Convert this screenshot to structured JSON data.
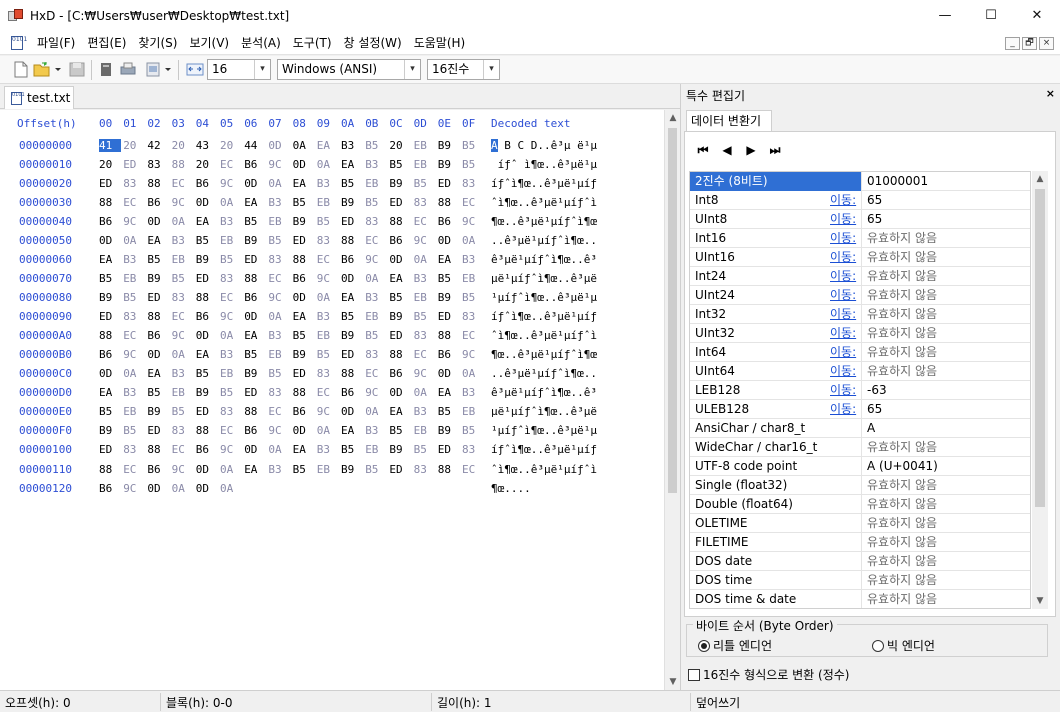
{
  "window": {
    "title": "HxD - [C:₩Users₩user₩Desktop₩test.txt]",
    "minimize": "—",
    "maximize": "☐",
    "close": "✕",
    "app_icon": "hxd-icon"
  },
  "menu": {
    "items": [
      "파일(F)",
      "편집(E)",
      "찾기(S)",
      "보기(V)",
      "분석(A)",
      "도구(T)",
      "창 설정(W)",
      "도움말(H)"
    ],
    "doc_icon_text": "0101",
    "mdi_minimize": "_",
    "mdi_restore": "🗗",
    "mdi_close": "×"
  },
  "toolbar": {
    "bytes_per_row": "16",
    "charset": "Windows (ANSI)",
    "offset_base": "16진수",
    "dropdown_arrow": "▾"
  },
  "tab": {
    "file_name": "test.txt",
    "icon_text": "0101"
  },
  "hex": {
    "header_offset": "Offset(h)",
    "header_columns": [
      "00",
      "01",
      "02",
      "03",
      "04",
      "05",
      "06",
      "07",
      "08",
      "09",
      "0A",
      "0B",
      "0C",
      "0D",
      "0E",
      "0F"
    ],
    "header_decoded": "Decoded text",
    "rows": [
      {
        "offset": "00000000",
        "bytes": [
          "41",
          "20",
          "42",
          "20",
          "43",
          "20",
          "44",
          "0D",
          "0A",
          "EA",
          "B3",
          "B5",
          "20",
          "EB",
          "B9",
          "B5"
        ],
        "decoded": "A B C D..ê³µ ë¹µ"
      },
      {
        "offset": "00000010",
        "bytes": [
          "20",
          "ED",
          "83",
          "88",
          "20",
          "EC",
          "B6",
          "9C",
          "0D",
          "0A",
          "EA",
          "B3",
          "B5",
          "EB",
          "B9",
          "B5"
        ],
        "decoded": " íƒˆ ì¶œ..ê³µë¹µ"
      },
      {
        "offset": "00000020",
        "bytes": [
          "ED",
          "83",
          "88",
          "EC",
          "B6",
          "9C",
          "0D",
          "0A",
          "EA",
          "B3",
          "B5",
          "EB",
          "B9",
          "B5",
          "ED",
          "83"
        ],
        "decoded": "íƒˆì¶œ..ê³µë¹µíƒ"
      },
      {
        "offset": "00000030",
        "bytes": [
          "88",
          "EC",
          "B6",
          "9C",
          "0D",
          "0A",
          "EA",
          "B3",
          "B5",
          "EB",
          "B9",
          "B5",
          "ED",
          "83",
          "88",
          "EC"
        ],
        "decoded": "ˆì¶œ..ê³µë¹µíƒˆì"
      },
      {
        "offset": "00000040",
        "bytes": [
          "B6",
          "9C",
          "0D",
          "0A",
          "EA",
          "B3",
          "B5",
          "EB",
          "B9",
          "B5",
          "ED",
          "83",
          "88",
          "EC",
          "B6",
          "9C"
        ],
        "decoded": "¶œ..ê³µë¹µíƒˆì¶œ"
      },
      {
        "offset": "00000050",
        "bytes": [
          "0D",
          "0A",
          "EA",
          "B3",
          "B5",
          "EB",
          "B9",
          "B5",
          "ED",
          "83",
          "88",
          "EC",
          "B6",
          "9C",
          "0D",
          "0A"
        ],
        "decoded": "..ê³µë¹µíƒˆì¶œ.."
      },
      {
        "offset": "00000060",
        "bytes": [
          "EA",
          "B3",
          "B5",
          "EB",
          "B9",
          "B5",
          "ED",
          "83",
          "88",
          "EC",
          "B6",
          "9C",
          "0D",
          "0A",
          "EA",
          "B3"
        ],
        "decoded": "ê³µë¹µíƒˆì¶œ..ê³"
      },
      {
        "offset": "00000070",
        "bytes": [
          "B5",
          "EB",
          "B9",
          "B5",
          "ED",
          "83",
          "88",
          "EC",
          "B6",
          "9C",
          "0D",
          "0A",
          "EA",
          "B3",
          "B5",
          "EB"
        ],
        "decoded": "µë¹µíƒˆì¶œ..ê³µë"
      },
      {
        "offset": "00000080",
        "bytes": [
          "B9",
          "B5",
          "ED",
          "83",
          "88",
          "EC",
          "B6",
          "9C",
          "0D",
          "0A",
          "EA",
          "B3",
          "B5",
          "EB",
          "B9",
          "B5"
        ],
        "decoded": "¹µíƒˆì¶œ..ê³µë¹µ"
      },
      {
        "offset": "00000090",
        "bytes": [
          "ED",
          "83",
          "88",
          "EC",
          "B6",
          "9C",
          "0D",
          "0A",
          "EA",
          "B3",
          "B5",
          "EB",
          "B9",
          "B5",
          "ED",
          "83"
        ],
        "decoded": "íƒˆì¶œ..ê³µë¹µíƒ"
      },
      {
        "offset": "000000A0",
        "bytes": [
          "88",
          "EC",
          "B6",
          "9C",
          "0D",
          "0A",
          "EA",
          "B3",
          "B5",
          "EB",
          "B9",
          "B5",
          "ED",
          "83",
          "88",
          "EC"
        ],
        "decoded": "ˆì¶œ..ê³µë¹µíƒˆì"
      },
      {
        "offset": "000000B0",
        "bytes": [
          "B6",
          "9C",
          "0D",
          "0A",
          "EA",
          "B3",
          "B5",
          "EB",
          "B9",
          "B5",
          "ED",
          "83",
          "88",
          "EC",
          "B6",
          "9C"
        ],
        "decoded": "¶œ..ê³µë¹µíƒˆì¶œ"
      },
      {
        "offset": "000000C0",
        "bytes": [
          "0D",
          "0A",
          "EA",
          "B3",
          "B5",
          "EB",
          "B9",
          "B5",
          "ED",
          "83",
          "88",
          "EC",
          "B6",
          "9C",
          "0D",
          "0A"
        ],
        "decoded": "..ê³µë¹µíƒˆì¶œ.."
      },
      {
        "offset": "000000D0",
        "bytes": [
          "EA",
          "B3",
          "B5",
          "EB",
          "B9",
          "B5",
          "ED",
          "83",
          "88",
          "EC",
          "B6",
          "9C",
          "0D",
          "0A",
          "EA",
          "B3"
        ],
        "decoded": "ê³µë¹µíƒˆì¶œ..ê³"
      },
      {
        "offset": "000000E0",
        "bytes": [
          "B5",
          "EB",
          "B9",
          "B5",
          "ED",
          "83",
          "88",
          "EC",
          "B6",
          "9C",
          "0D",
          "0A",
          "EA",
          "B3",
          "B5",
          "EB"
        ],
        "decoded": "µë¹µíƒˆì¶œ..ê³µë"
      },
      {
        "offset": "000000F0",
        "bytes": [
          "B9",
          "B5",
          "ED",
          "83",
          "88",
          "EC",
          "B6",
          "9C",
          "0D",
          "0A",
          "EA",
          "B3",
          "B5",
          "EB",
          "B9",
          "B5"
        ],
        "decoded": "¹µíƒˆì¶œ..ê³µë¹µ"
      },
      {
        "offset": "00000100",
        "bytes": [
          "ED",
          "83",
          "88",
          "EC",
          "B6",
          "9C",
          "0D",
          "0A",
          "EA",
          "B3",
          "B5",
          "EB",
          "B9",
          "B5",
          "ED",
          "83"
        ],
        "decoded": "íƒˆì¶œ..ê³µë¹µíƒ"
      },
      {
        "offset": "00000110",
        "bytes": [
          "88",
          "EC",
          "B6",
          "9C",
          "0D",
          "0A",
          "EA",
          "B3",
          "B5",
          "EB",
          "B9",
          "B5",
          "ED",
          "83",
          "88",
          "EC"
        ],
        "decoded": "ˆì¶œ..ê³µë¹µíƒˆì"
      },
      {
        "offset": "00000120",
        "bytes": [
          "B6",
          "9C",
          "0D",
          "0A",
          "0D",
          "0A"
        ],
        "decoded": "¶œ...."
      }
    ]
  },
  "panel": {
    "title": "특수 편집기",
    "close": "×",
    "tab_label": "데이터 변환기",
    "nav": [
      "⏮",
      "◀",
      "▶",
      "⏭"
    ],
    "goto_label": "이동:",
    "rows": [
      {
        "name": "2진수 (8비트)",
        "value": "01000001",
        "goto": false,
        "invalid": false,
        "selected": true
      },
      {
        "name": "Int8",
        "value": "65",
        "goto": true,
        "invalid": false
      },
      {
        "name": "UInt8",
        "value": "65",
        "goto": true,
        "invalid": false
      },
      {
        "name": "Int16",
        "value": "유효하지 않음",
        "goto": true,
        "invalid": true
      },
      {
        "name": "UInt16",
        "value": "유효하지 않음",
        "goto": true,
        "invalid": true
      },
      {
        "name": "Int24",
        "value": "유효하지 않음",
        "goto": true,
        "invalid": true
      },
      {
        "name": "UInt24",
        "value": "유효하지 않음",
        "goto": true,
        "invalid": true
      },
      {
        "name": "Int32",
        "value": "유효하지 않음",
        "goto": true,
        "invalid": true
      },
      {
        "name": "UInt32",
        "value": "유효하지 않음",
        "goto": true,
        "invalid": true
      },
      {
        "name": "Int64",
        "value": "유효하지 않음",
        "goto": true,
        "invalid": true
      },
      {
        "name": "UInt64",
        "value": "유효하지 않음",
        "goto": true,
        "invalid": true
      },
      {
        "name": "LEB128",
        "value": "-63",
        "goto": true,
        "invalid": false
      },
      {
        "name": "ULEB128",
        "value": "65",
        "goto": true,
        "invalid": false
      },
      {
        "name": "AnsiChar / char8_t",
        "value": "A",
        "goto": false,
        "invalid": false
      },
      {
        "name": "WideChar / char16_t",
        "value": "유효하지 않음",
        "goto": false,
        "invalid": true
      },
      {
        "name": "UTF-8 code point",
        "value": "A (U+0041)",
        "goto": false,
        "invalid": false
      },
      {
        "name": "Single (float32)",
        "value": "유효하지 않음",
        "goto": false,
        "invalid": true
      },
      {
        "name": "Double (float64)",
        "value": "유효하지 않음",
        "goto": false,
        "invalid": true
      },
      {
        "name": "OLETIME",
        "value": "유효하지 않음",
        "goto": false,
        "invalid": true
      },
      {
        "name": "FILETIME",
        "value": "유효하지 않음",
        "goto": false,
        "invalid": true
      },
      {
        "name": "DOS date",
        "value": "유효하지 않음",
        "goto": false,
        "invalid": true
      },
      {
        "name": "DOS time",
        "value": "유효하지 않음",
        "goto": false,
        "invalid": true
      },
      {
        "name": "DOS time & date",
        "value": "유효하지 않음",
        "goto": false,
        "invalid": true
      }
    ],
    "byte_order_label": "바이트 순서 (Byte Order)",
    "little_endian": "리틀 엔디언",
    "big_endian": "빅 엔디언",
    "hex_option": "16진수 형식으로 변환 (정수)"
  },
  "status": {
    "offset": "오프셋(h): 0",
    "block": "블록(h): 0-0",
    "length": "길이(h): 1",
    "mode": "덮어쓰기"
  },
  "colors": {
    "offset_blue": "#2d4ed4",
    "selection": "#2f6fd4",
    "alt_byte": "#8a8aa8",
    "invalid": "#6d6d6d"
  }
}
